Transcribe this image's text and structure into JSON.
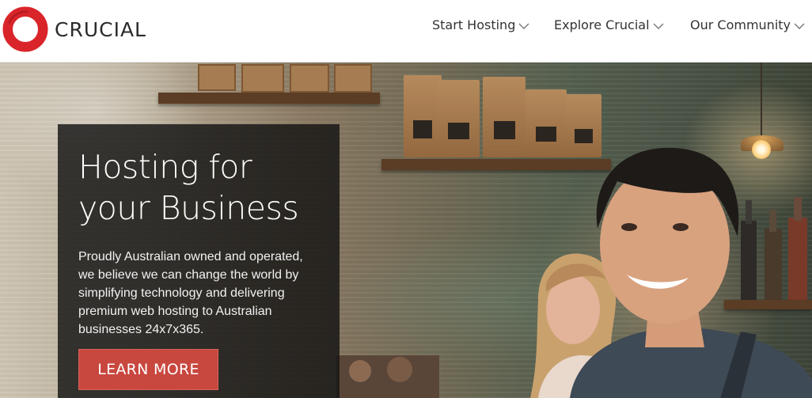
{
  "brand": {
    "name": "CRUCIAL",
    "logo_icon": "red-ring-logo",
    "colors": {
      "accent": "#d9252a",
      "text": "#2b2b2b",
      "cta": "#c8473f"
    }
  },
  "nav": {
    "items": [
      {
        "label": "Start Hosting",
        "icon": "chevron-down-icon"
      },
      {
        "label": "Explore Crucial",
        "icon": "chevron-down-icon"
      },
      {
        "label": "Our Community",
        "icon": "chevron-down-icon"
      }
    ]
  },
  "hero": {
    "title_line1": "Hosting for",
    "title_line2": "your Business",
    "body": "Proudly Australian owned and operated, we believe we can change the world by simplifying technology and delivering premium web hosting to Australian businesses 24x7x365.",
    "cta_label": "LEARN MORE",
    "background": "cafe-photo"
  }
}
